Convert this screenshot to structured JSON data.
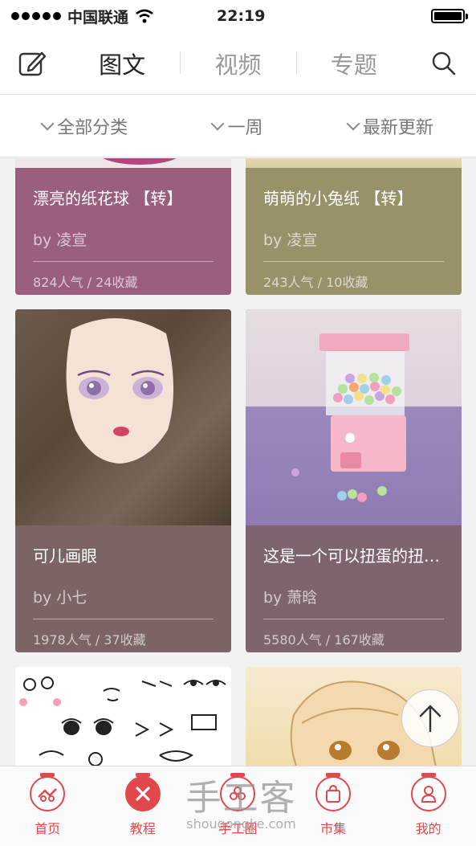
{
  "status_bar": {
    "carrier": "中国联通",
    "time": "22:19"
  },
  "top_nav": {
    "tabs": [
      {
        "label": "图文",
        "active": true
      },
      {
        "label": "视频",
        "active": false
      },
      {
        "label": "专题",
        "active": false
      }
    ]
  },
  "filters": [
    {
      "label": "全部分类"
    },
    {
      "label": "一周"
    },
    {
      "label": "最新更新"
    }
  ],
  "cards": [
    {
      "title": "漂亮的纸花球 【转】",
      "author_prefix": "by",
      "author": "凌宣",
      "stats": "824人气 / 24收藏",
      "color": "#9b5f7e"
    },
    {
      "title": "萌萌的小兔纸 【转】",
      "author_prefix": "by",
      "author": "凌宣",
      "stats": "243人气 / 10收藏",
      "color": "#97926a"
    },
    {
      "title": "可儿画眼",
      "author_prefix": "by",
      "author": "小七",
      "stats": "1978人气 / 37收藏",
      "color": "#7c6465"
    },
    {
      "title": "这是一个可以扭蛋的扭蛋机",
      "author_prefix": "by",
      "author": "萧晗",
      "stats": "5580人气 / 167收藏",
      "color": "#7d6470"
    }
  ],
  "tab_bar": {
    "items": [
      {
        "label": "首页"
      },
      {
        "label": "教程"
      },
      {
        "label": "手工圈"
      },
      {
        "label": "市集"
      },
      {
        "label": "我的"
      }
    ]
  },
  "watermark": {
    "big": "手工客",
    "small": "shougongke.com"
  },
  "colors": {
    "accent": "#e0484b"
  }
}
